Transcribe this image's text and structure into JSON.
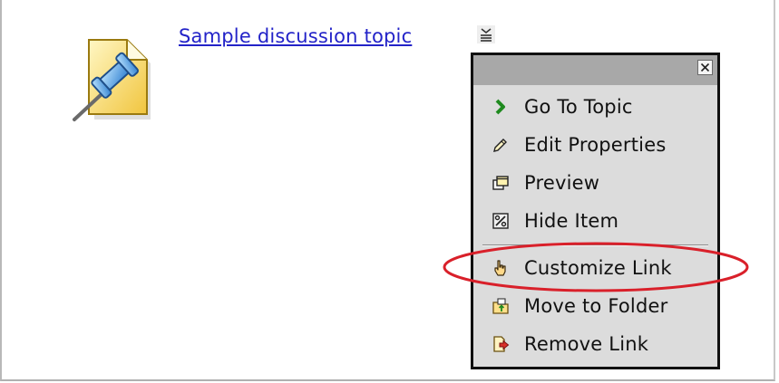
{
  "topic": {
    "link_text": "Sample discussion topic",
    "icon": "pushpin-document-icon"
  },
  "menu": {
    "trigger_icon": "chevron-menu-icon",
    "close_icon": "close-icon",
    "items": [
      {
        "label": "Go To Topic",
        "icon": "green-arrow-icon"
      },
      {
        "label": "Edit Properties",
        "icon": "pencil-icon"
      },
      {
        "label": "Preview",
        "icon": "preview-windows-icon"
      },
      {
        "label": "Hide Item",
        "icon": "hide-item-icon"
      },
      {
        "label": "Customize Link",
        "icon": "hand-pointer-icon"
      },
      {
        "label": "Move to Folder",
        "icon": "folder-move-icon"
      },
      {
        "label": "Remove Link",
        "icon": "remove-link-icon"
      }
    ]
  },
  "annotation": {
    "highlight_color": "#d9202a",
    "highlighted_item": "Customize Link"
  },
  "colors": {
    "link": "#2323c8",
    "menu_bg": "#dcdcdc",
    "menu_header": "#a8a8a8",
    "menu_border": "#101010"
  }
}
